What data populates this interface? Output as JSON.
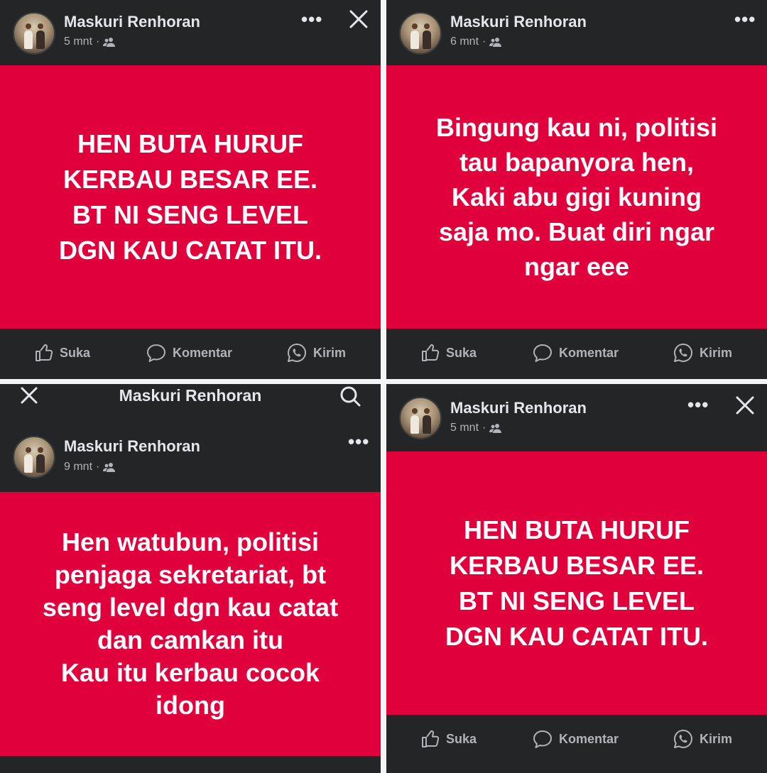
{
  "posts": [
    {
      "author": "Maskuri Renhoran",
      "time": "5 mnt",
      "separator": "·",
      "more_icon": "more-icon",
      "text": "HEN BUTA HURUF\nKERBAU BESAR EE.\nBT NI SENG LEVEL\nDGN KAU CATAT ITU.",
      "background_color": "#e0003b",
      "actions": {
        "like": "Suka",
        "comment": "Komentar",
        "send": "Kirim"
      }
    },
    {
      "author": "Maskuri Renhoran",
      "time": "6 mnt",
      "separator": "·",
      "more_icon": "more-icon",
      "text": "Bingung kau ni, politisi\ntau bapanyora hen,\nKaki abu gigi kuning\nsaja mo. Buat diri ngar\nngar eee",
      "background_color": "#e0003b",
      "actions": {
        "like": "Suka",
        "comment": "Komentar",
        "send": "Kirim"
      }
    },
    {
      "topbar_title": "Maskuri Renhoran",
      "author": "Maskuri Renhoran",
      "time": "9 mnt",
      "separator": "·",
      "more_icon": "more-icon",
      "text": "Hen watubun, politisi\npenjaga sekretariat, bt\nseng level dgn kau catat\ndan camkan itu\nKau itu kerbau cocok\nidong",
      "background_color": "#e0003b"
    },
    {
      "author": "Maskuri Renhoran",
      "time": "5 mnt",
      "separator": "·",
      "more_icon": "more-icon",
      "text": "HEN BUTA HURUF\nKERBAU BESAR EE.\nBT NI SENG LEVEL\nDGN KAU CATAT ITU.",
      "background_color": "#e0003b",
      "actions": {
        "like": "Suka",
        "comment": "Komentar",
        "send": "Kirim"
      }
    }
  ],
  "theme": {
    "panel_bg": "#242526",
    "text_primary": "#e4e6eb",
    "text_secondary": "#b0b3b8",
    "post_red": "#e0003b"
  }
}
